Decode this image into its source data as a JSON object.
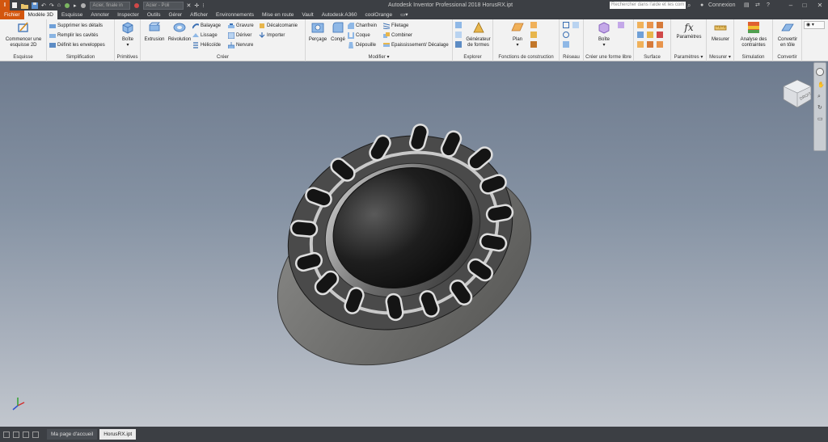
{
  "titlebar": {
    "app_letter": "I",
    "material_dropdown": "Acier, finale in",
    "appearance_dropdown": "Acier - Poli",
    "document_title": "Autodesk Inventor Professional 2018   HorusRX.ipt",
    "search_placeholder": "Rechercher dans l'aide et les com",
    "signin": "Connexion",
    "help": "?"
  },
  "menu_tabs": [
    "Fichier",
    "Modèle 3D",
    "Esquisse",
    "Annoter",
    "Inspecter",
    "Outils",
    "Gérer",
    "Afficher",
    "Environnements",
    "Mise en route",
    "Vault",
    "Autodesk A360",
    "coolOrange"
  ],
  "ribbon": {
    "esquisse": {
      "label": "Esquisse",
      "button": "Commencer une esquisse 2D"
    },
    "simplification": {
      "label": "Simplification",
      "items": [
        "Supprimer les détails",
        "Remplir les cavités",
        "Définit les enveloppes"
      ]
    },
    "primitives": {
      "label": "Primitives",
      "button": "Boîte"
    },
    "creer": {
      "label": "Créer",
      "extrusion": "Extrusion",
      "revolution": "Révolution",
      "col1": [
        "Balayage",
        "Lissage",
        "Hélicoïde"
      ],
      "col2": [
        "Gravure",
        "Dériver",
        "Nervure"
      ],
      "col3": [
        "Décalcomanie",
        "Importer"
      ]
    },
    "modifier": {
      "label": "Modifier ▾",
      "percage": "Perçage",
      "conge": "Congé",
      "col1": [
        "Chanfrein",
        "Coque",
        "Dépouille"
      ],
      "col2": [
        "Filetage",
        "Combiner",
        "Epaississement/ Décalage"
      ]
    },
    "explorer": {
      "label": "Explorer",
      "button": "Générateur de formes"
    },
    "fonctions": {
      "label": "Fonctions de construction",
      "button": "Plan"
    },
    "reseau": {
      "label": "Réseau"
    },
    "forme_libre": {
      "label": "Créer une forme libre",
      "button": "Boîte"
    },
    "surface": {
      "label": "Surface"
    },
    "parametres": {
      "label": "Paramètres ▾",
      "button": "Paramètres",
      "glyph": "fx"
    },
    "mesurer": {
      "label": "Mesurer ▾",
      "button": "Mesurer"
    },
    "simulation": {
      "label": "Simulation",
      "button": "Analyse des contraintes"
    },
    "convertir": {
      "label": "Convertir",
      "button": "Convertir en tôle"
    }
  },
  "viewcube": {
    "face": "DROIT"
  },
  "status_tabs": [
    "Ma page d'accueil",
    "HorusRX.ipt"
  ],
  "colors": {
    "chrome": "#3c3f44",
    "file_tab": "#d3560e",
    "ribbon": "#f2f2f2",
    "viewport_top": "#6e7b8e",
    "viewport_bottom": "#c2c7ce"
  }
}
